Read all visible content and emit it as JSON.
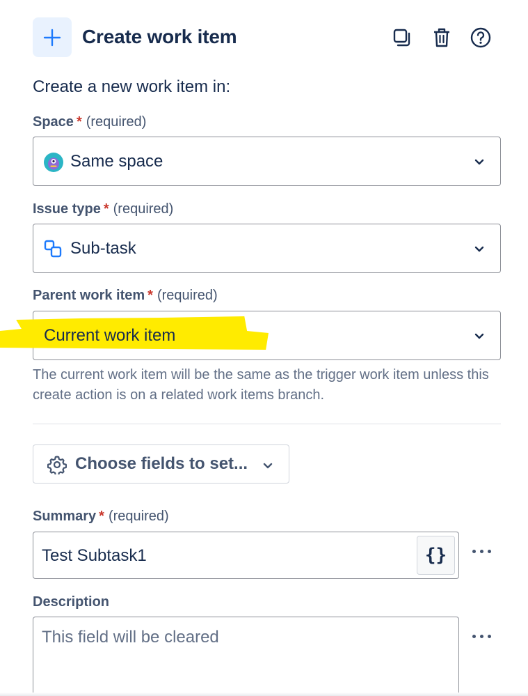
{
  "header": {
    "title": "Create work item",
    "icons": [
      "plus-icon",
      "duplicate-icon",
      "trash-icon",
      "help-icon"
    ]
  },
  "intro_text": "Create a new work item in:",
  "required_marker": "*",
  "required_note": "(required)",
  "space": {
    "label": "Space",
    "value": "Same space",
    "icon": "space-avatar-icon"
  },
  "issue_type": {
    "label": "Issue type",
    "value": "Sub-task",
    "icon": "subtask-icon"
  },
  "parent": {
    "label": "Parent work item",
    "value": "Current work item",
    "helper": "The current work item will be the same as the trigger work item unless this create action is on a related work items branch.",
    "highlight_color": "#ffeb00"
  },
  "choose_fields_button": "Choose fields to set...",
  "summary": {
    "label": "Summary",
    "value": "Test Subtask1",
    "smart_value_button": "{}"
  },
  "description": {
    "label": "Description",
    "placeholder": "This field will be cleared"
  },
  "colors": {
    "accent": "#1d7afc",
    "required_star": "#c9372c",
    "text": "#172b4d",
    "subtle_text": "#44546f"
  }
}
